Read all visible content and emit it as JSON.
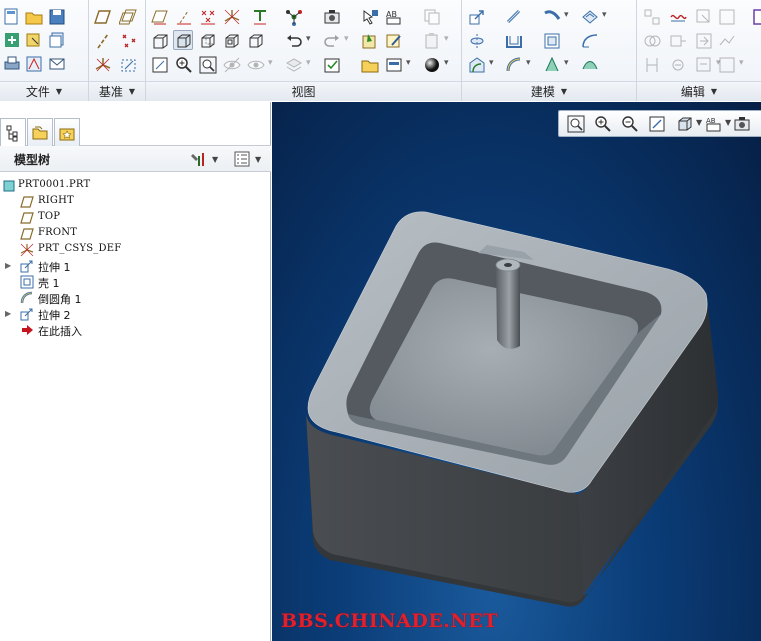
{
  "ribbon": {
    "groups": [
      {
        "id": "file",
        "label": "文件"
      },
      {
        "id": "datum",
        "label": "基准"
      },
      {
        "id": "view",
        "label": "视图"
      },
      {
        "id": "model",
        "label": "建模"
      },
      {
        "id": "edit",
        "label": "编辑"
      }
    ]
  },
  "navigator": {
    "tabs": [
      "model-tree-tab",
      "folder-browser-tab",
      "favorites-tab"
    ]
  },
  "model_tree": {
    "title": "模型树",
    "items": [
      {
        "label": "PRT0001.PRT",
        "icon": "part-icon",
        "expandable": false,
        "level": 0
      },
      {
        "label": "RIGHT",
        "icon": "datum-plane-icon",
        "expandable": false,
        "level": 1
      },
      {
        "label": "TOP",
        "icon": "datum-plane-icon",
        "expandable": false,
        "level": 1
      },
      {
        "label": "FRONT",
        "icon": "datum-plane-icon",
        "expandable": false,
        "level": 1
      },
      {
        "label": "PRT_CSYS_DEF",
        "icon": "csys-icon",
        "expandable": false,
        "level": 1
      },
      {
        "label": "拉伸 1",
        "icon": "extrude-icon",
        "expandable": true,
        "level": 1
      },
      {
        "label": "壳 1",
        "icon": "shell-icon",
        "expandable": false,
        "level": 1
      },
      {
        "label": "倒圆角 1",
        "icon": "round-icon",
        "expandable": false,
        "level": 1
      },
      {
        "label": "拉伸 2",
        "icon": "extrude-icon",
        "expandable": true,
        "level": 1
      },
      {
        "label": "在此插入",
        "icon": "insert-here-arrow-icon",
        "expandable": false,
        "level": 1
      }
    ]
  },
  "viewport": {
    "watermark": "BBS.CHINADE.NET",
    "background_colors": [
      "#061f45",
      "#1a5a9c"
    ],
    "model_colors": {
      "top": "#a9b0b6",
      "side": "#3f4245",
      "inner": "#7f878e"
    }
  },
  "colors": {
    "accent": "#2f6db5",
    "ribbon_bg": "#eef2f7"
  }
}
